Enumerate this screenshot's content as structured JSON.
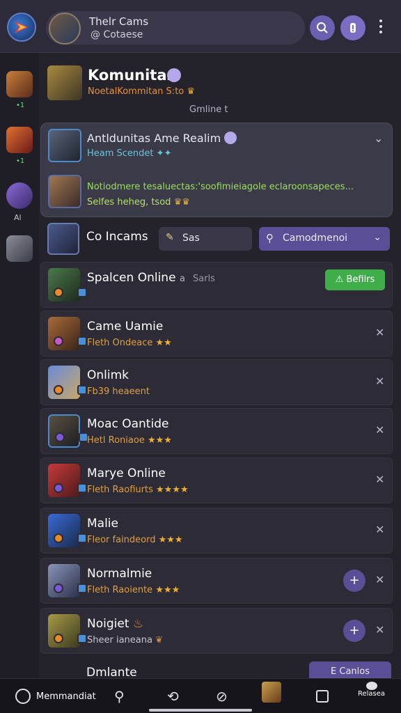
{
  "topbar": {
    "profile_name": "Thelr Cams",
    "profile_handle": "@ Cotaese"
  },
  "rail": {
    "items": [
      {
        "dot": "•1"
      },
      {
        "dot": "•1"
      },
      {
        "label": "Al"
      },
      {}
    ]
  },
  "community": {
    "title": "Komunitas",
    "subtitle": "NoetalKommitan S:to",
    "status": "Gmline  t"
  },
  "expanded": {
    "title": "Antldunitas Ame Realim",
    "subtitle": "Heam Scendet",
    "message": "Notiodmere tesaluectas:'soofimieiagole eclaroonsapeces...",
    "meta": "Selfes heheg, tsod"
  },
  "filter": {
    "title": "Co Incams",
    "button_label": "Sas",
    "select_label": "Camodmenoi"
  },
  "items": [
    {
      "name": "Spalcen Online",
      "suffix": "a",
      "tag": "Sarls",
      "cta": "Befilrs"
    },
    {
      "name": "Came Uamie",
      "sub": "Fleth Ondeace",
      "stars": "★★"
    },
    {
      "name": "Onlimk",
      "sub": "Fb39 heaeent",
      "stars": ""
    },
    {
      "name": "Moac Oantide",
      "sub": "Hetl Roniaoe",
      "stars": "★★★"
    },
    {
      "name": "Marye Online",
      "sub": "Fleth Raofiurts",
      "stars": "★★★★"
    },
    {
      "name": "Malie",
      "sub": "Fleor faindeord",
      "stars": "★★★"
    },
    {
      "name": "Normalmie",
      "sub": "Fleth Raoiente",
      "stars": "★★★"
    },
    {
      "name": "Noigiet",
      "sub": "Sheer ianeana",
      "stars": ""
    }
  ],
  "peek": {
    "name": "Dmlante",
    "button": "E Canlos"
  },
  "bottom_nav": {
    "first_label": "Memmandiat",
    "last_label": "Relasea"
  },
  "colors": {
    "accent": "#5a4f96",
    "cta_green": "#3fae4a",
    "orange_sub": "#e0a040"
  }
}
